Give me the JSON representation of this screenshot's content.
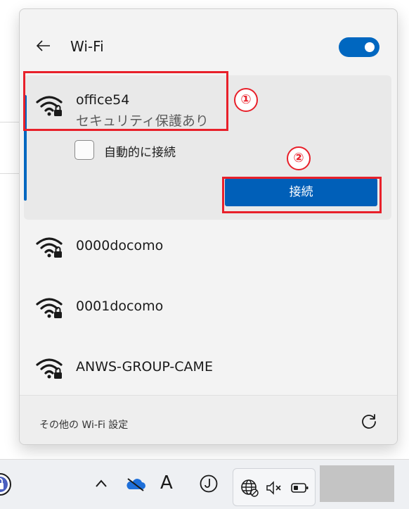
{
  "header": {
    "title": "Wi-Fi",
    "wifi_enabled": true
  },
  "networks": [
    {
      "name": "office54",
      "status": "セキュリティ保護あり",
      "secured": true,
      "selected": true
    },
    {
      "name": "0000docomo",
      "secured": true
    },
    {
      "name": "0001docomo",
      "secured": true
    },
    {
      "name": "ANWS-GROUP-CAME",
      "secured": true
    }
  ],
  "selected_network": {
    "auto_connect_label": "自動的に接続",
    "auto_connect_checked": false,
    "connect_label": "接続"
  },
  "footer": {
    "more_settings": "その他の Wi-Fi 設定"
  },
  "annotations": {
    "step1": "①",
    "step2": "②"
  },
  "taskbar": {
    "ime_mode": "A"
  },
  "colors": {
    "accent": "#005fb8",
    "annotation": "#e8202a"
  }
}
